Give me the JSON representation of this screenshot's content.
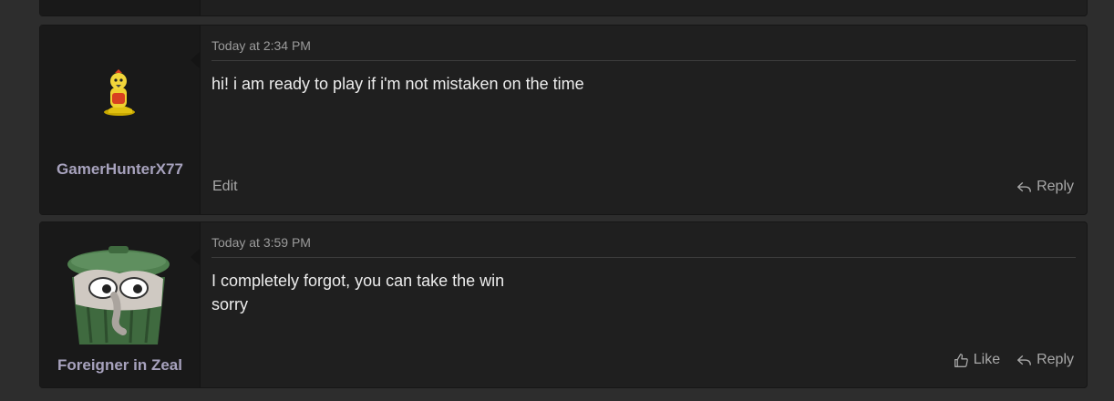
{
  "posts": [
    {
      "username": "GamerHunterX77",
      "avatar_icon": "pokemon-sprite-icon",
      "timestamp": "Today at 2:34 PM",
      "lines": [
        "hi! i am ready to play if i'm not mistaken on the time"
      ],
      "edit_label": "Edit",
      "reply_label": "Reply"
    },
    {
      "username": "Foreigner in Zeal",
      "avatar_icon": "trash-can-creature-icon",
      "timestamp": "Today at 3:59 PM",
      "lines": [
        "I completely forgot, you can take the win",
        "sorry"
      ],
      "like_label": "Like",
      "reply_label": "Reply"
    }
  ],
  "colors": {
    "username": "#a7a2bd",
    "post_bg": "#1f1f1f",
    "page_bg": "#2d2d2d"
  }
}
